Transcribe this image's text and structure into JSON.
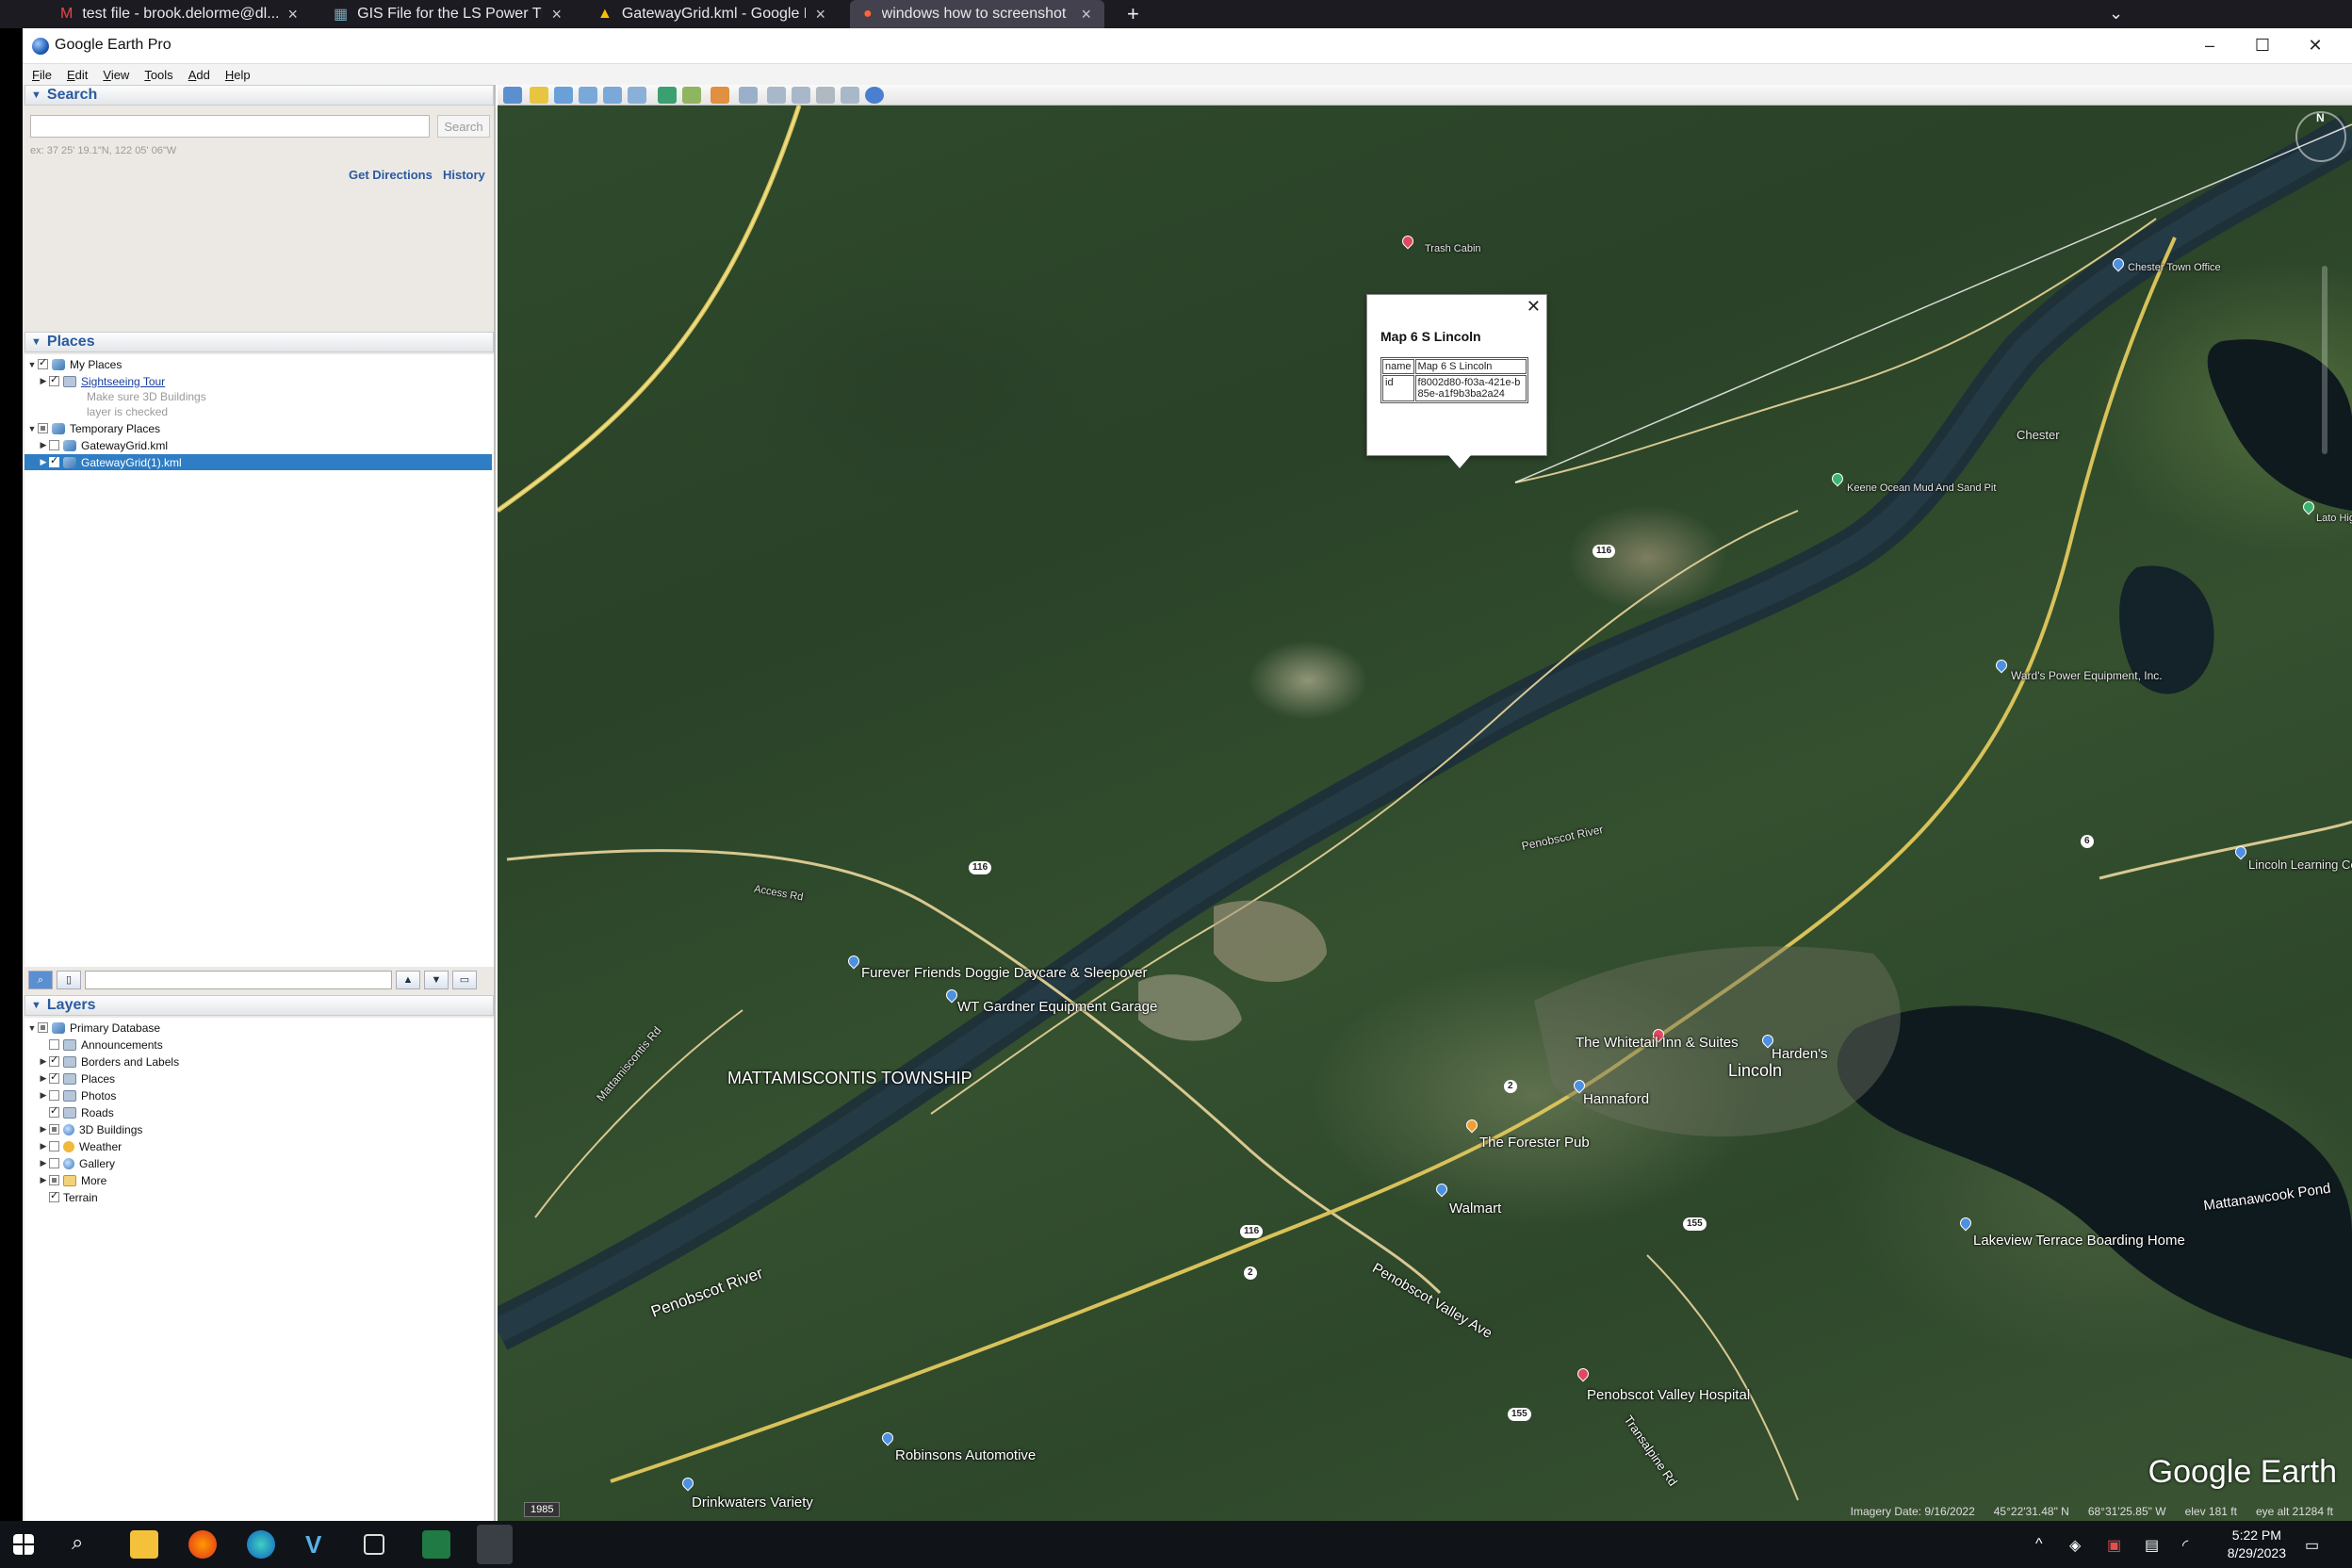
{
  "browser": {
    "tabs": [
      {
        "label": "test file - brook.delorme@dl...",
        "active": false
      },
      {
        "label": "GIS File for the LS Power Trans...",
        "active": false
      },
      {
        "label": "GatewayGrid.kml - Google Dri...",
        "active": false
      },
      {
        "label": "windows how to screenshot ...",
        "active": true
      }
    ],
    "new_tab": "+",
    "list_all": "⌄"
  },
  "window": {
    "title": "Google Earth Pro",
    "minimize": "–",
    "maximize": "☐",
    "close": "✕"
  },
  "menu": [
    "File",
    "Edit",
    "View",
    "Tools",
    "Add",
    "Help"
  ],
  "search": {
    "header": "Search",
    "input_value": "",
    "button": "Search",
    "hint": "ex: 37 25' 19.1\"N, 122 05' 06\"W",
    "get_directions": "Get Directions",
    "history": "History"
  },
  "places": {
    "header": "Places",
    "items": [
      {
        "label": "My Places",
        "level": 0,
        "checked": "on"
      },
      {
        "label": "Sightseeing Tour",
        "level": 1,
        "checked": "on"
      },
      {
        "label": "Make sure 3D Buildings",
        "level": 2
      },
      {
        "label": "layer is checked",
        "level": 2
      },
      {
        "label": "Temporary Places",
        "level": 0,
        "checked": "part"
      },
      {
        "label": "GatewayGrid.kml",
        "level": 1,
        "checked": "off"
      },
      {
        "label": "GatewayGrid(1).kml",
        "level": 1,
        "checked": "on",
        "selected": true
      }
    ]
  },
  "layers": {
    "header": "Layers",
    "items": [
      {
        "label": "Primary Database",
        "level": 0,
        "checked": "part"
      },
      {
        "label": "Announcements",
        "level": 1,
        "checked": "off"
      },
      {
        "label": "Borders and Labels",
        "level": 1,
        "checked": "on"
      },
      {
        "label": "Places",
        "level": 1,
        "checked": "on"
      },
      {
        "label": "Photos",
        "level": 1,
        "checked": "off"
      },
      {
        "label": "Roads",
        "level": 1,
        "checked": "on"
      },
      {
        "label": "3D Buildings",
        "level": 1,
        "checked": "part"
      },
      {
        "label": "Weather",
        "level": 1,
        "checked": "off"
      },
      {
        "label": "Gallery",
        "level": 1,
        "checked": "off"
      },
      {
        "label": "More",
        "level": 1,
        "checked": "part"
      },
      {
        "label": "Terrain",
        "level": 0,
        "checked": "on"
      }
    ]
  },
  "balloon": {
    "title": "Map 6 S Lincoln",
    "rows": [
      {
        "key": "name",
        "value": "Map 6 S Lincoln"
      },
      {
        "key": "id",
        "value": "f8002d80-f03a-421e-b85e-a1f9b3ba2a24"
      }
    ],
    "close": "✕"
  },
  "map_labels": {
    "trash_cabin": "Trash Cabin",
    "keene": "Keene Ocean Mud And Sand Pit",
    "chester_town_office": "Chester Town Office",
    "chester": "Chester",
    "golf": "Lato Highlands Golf Course",
    "power_equipment": "Ward's Power Equipment, Inc.",
    "penobscot_river_upper": "Penobscot River",
    "access_rd": "Access Rd",
    "furever": "Furever Friends Doggie Daycare & Sleepover",
    "wt_gardner": "WT Gardner Equipment Garage",
    "mattamiscontis": "MATTAMISCONTIS TOWNSHIP",
    "whitetail": "The Whitetail Inn & Suites",
    "hardens": "Harden's",
    "lincoln": "Lincoln",
    "hannaford": "Hannaford",
    "forester_pub": "The Forester Pub",
    "walmart": "Walmart",
    "mattanawcook_pond": "Mattanawcook Pond",
    "lakeview": "Lakeview Terrace Boarding Home",
    "lincoln_learning": "Lincoln Learning Cent",
    "penobscot_valley_ave": "Penobscot Valley Ave",
    "penobscot_river_lower": "Penobscot River",
    "mattamiscontis_rd": "Mattamiscontis Rd",
    "penobscot_valley_hospital": "Penobscot Valley Hospital",
    "transalpine_rd": "Transalpine Rd",
    "robinsons": "Robinsons Automotive",
    "drinkwaters": "Drinkwaters Variety",
    "rt116_a": "116",
    "rt116_b": "116",
    "rt116_c": "116",
    "rt2_a": "2",
    "rt2_b": "2",
    "rt155_a": "155",
    "rt155_b": "155",
    "rt6": "6"
  },
  "map": {
    "logo": "Google Earth",
    "history_year": "1985",
    "compass_n": "N",
    "status": {
      "imagery_date": "Imagery Date: 9/16/2022",
      "lat": "45°22'31.48\" N",
      "lon": "68°31'25.85\" W",
      "elev": "elev 181 ft",
      "eye_alt": "eye alt 21284 ft"
    }
  },
  "taskbar": {
    "time": "5:22 PM",
    "date": "8/29/2023"
  }
}
